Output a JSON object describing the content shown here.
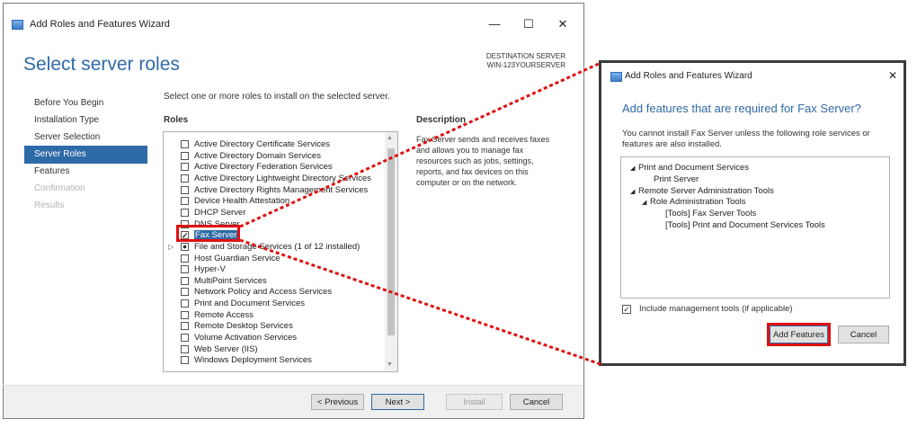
{
  "wizard": {
    "title": "Add Roles and Features Wizard",
    "minimize_glyph": "—",
    "maximize_glyph": "☐",
    "close_glyph": "✕",
    "heading": "Select server roles",
    "destination_label": "DESTINATION SERVER",
    "destination_value": "WIN-123YOURSERVER",
    "nav": [
      {
        "label": "Before You Begin",
        "state": "normal"
      },
      {
        "label": "Installation Type",
        "state": "normal"
      },
      {
        "label": "Server Selection",
        "state": "normal"
      },
      {
        "label": "Server Roles",
        "state": "selected"
      },
      {
        "label": "Features",
        "state": "normal"
      },
      {
        "label": "Confirmation",
        "state": "disabled"
      },
      {
        "label": "Results",
        "state": "disabled"
      }
    ],
    "instruction": "Select one or more roles to install on the selected server.",
    "roles_header": "Roles",
    "roles": [
      {
        "label": "Active Directory Certificate Services",
        "checked": false
      },
      {
        "label": "Active Directory Domain Services",
        "checked": false
      },
      {
        "label": "Active Directory Federation Services",
        "checked": false
      },
      {
        "label": "Active Directory Lightweight Directory Services",
        "checked": false
      },
      {
        "label": "Active Directory Rights Management Services",
        "checked": false
      },
      {
        "label": "Device Health Attestation",
        "checked": false
      },
      {
        "label": "DHCP Server",
        "checked": false
      },
      {
        "label": "DNS Server",
        "checked": false
      },
      {
        "label": "Fax Server",
        "checked": true,
        "selected": true
      },
      {
        "label": "File and Storage Services (1 of 12 installed)",
        "checked": "partial",
        "expander": true
      },
      {
        "label": "Host Guardian Service",
        "checked": false
      },
      {
        "label": "Hyper-V",
        "checked": false
      },
      {
        "label": "MultiPoint Services",
        "checked": false
      },
      {
        "label": "Network Policy and Access Services",
        "checked": false
      },
      {
        "label": "Print and Document Services",
        "checked": false
      },
      {
        "label": "Remote Access",
        "checked": false
      },
      {
        "label": "Remote Desktop Services",
        "checked": false
      },
      {
        "label": "Volume Activation Services",
        "checked": false
      },
      {
        "label": "Web Server (IIS)",
        "checked": false
      },
      {
        "label": "Windows Deployment Services",
        "checked": false
      }
    ],
    "description_header": "Description",
    "description": "Fax Server sends and receives faxes and allows you to manage fax resources such as jobs, settings, reports, and fax devices on this computer or on the network.",
    "buttons": {
      "previous": "< Previous",
      "next": "Next >",
      "install": "Install",
      "cancel": "Cancel"
    }
  },
  "dialog": {
    "title": "Add Roles and Features Wizard",
    "close_glyph": "✕",
    "heading": "Add features that are required for Fax Server?",
    "message": "You cannot install Fax Server unless the following role services or features are also installed.",
    "tree": [
      {
        "label": "Print and Document Services",
        "level": 0,
        "expander": true
      },
      {
        "label": "Print Server",
        "level": 1,
        "expander": false
      },
      {
        "label": "Remote Server Administration Tools",
        "level": 0,
        "expander": true
      },
      {
        "label": "Role Administration Tools",
        "level": 1,
        "expander": true
      },
      {
        "label": "[Tools] Fax Server Tools",
        "level": 2,
        "expander": false
      },
      {
        "label": "[Tools] Print and Document Services Tools",
        "level": 2,
        "expander": false
      }
    ],
    "include_tools_label": "Include management tools (if applicable)",
    "include_tools_checked": true,
    "add_features": "Add Features",
    "cancel": "Cancel"
  },
  "colors": {
    "accent": "#2f6aa8",
    "highlight": "#e01010"
  }
}
